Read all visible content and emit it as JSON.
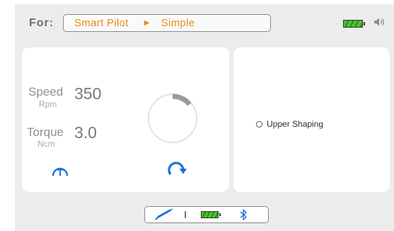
{
  "header": {
    "for_label": "For:",
    "breadcrumb": {
      "first": "Smart Pilot",
      "separator_icon": "triangle-right-icon",
      "second": "Simple"
    },
    "battery_icon": "battery-full-icon",
    "speaker_icon": "speaker-volume-icon"
  },
  "motor": {
    "speed": {
      "label": "Speed",
      "unit": "Rpm",
      "value": "350"
    },
    "torque": {
      "label": "Torque",
      "unit": "Ncm",
      "value": "3.0"
    },
    "gauge_level": 0.14,
    "torque_mode_icon": "torque-gauge-icon",
    "rotation_icon": "clockwise-rotation-icon"
  },
  "modes": {
    "items": [
      {
        "label": "Upper Shaping",
        "selected": false
      }
    ]
  },
  "status": {
    "handpiece_icon": "handpiece-icon",
    "battery_icon": "battery-full-icon",
    "bluetooth_icon": "bluetooth-icon"
  },
  "colors": {
    "accent_orange": "#ee8a17",
    "icon_blue": "#1f6fd6",
    "battery_green": "#4cc22b",
    "gauge_fill": "#9a9a9a"
  }
}
